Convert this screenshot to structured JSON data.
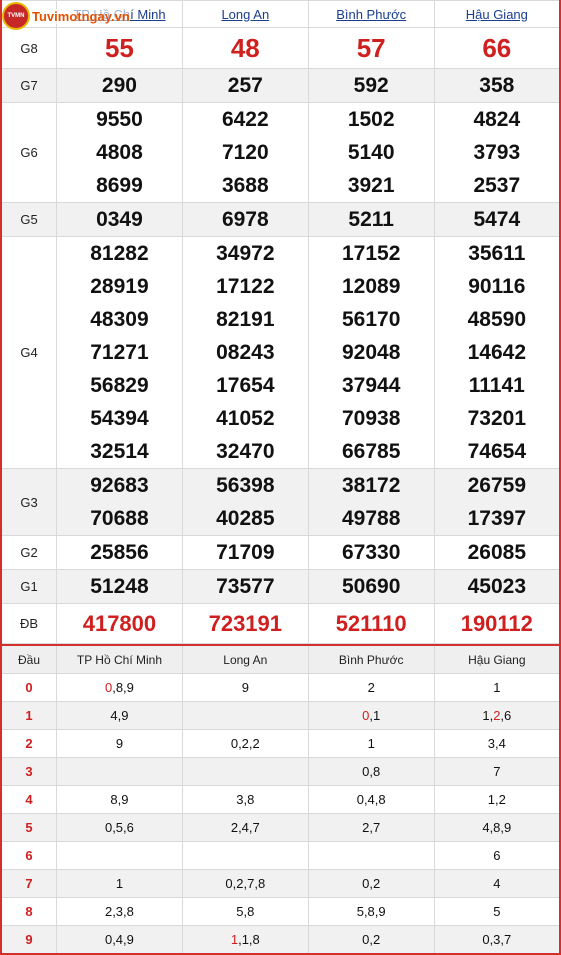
{
  "logo": {
    "text": "Tuvimotngay.vn",
    "badge": "TVMN"
  },
  "provinces": [
    "TP Hồ Chí Minh",
    "Long An",
    "Bình Phước",
    "Hậu Giang"
  ],
  "prizes": [
    {
      "label": "G8",
      "values": [
        [
          "55"
        ],
        [
          "48"
        ],
        [
          "57"
        ],
        [
          "66"
        ]
      ]
    },
    {
      "label": "G7",
      "values": [
        [
          "290"
        ],
        [
          "257"
        ],
        [
          "592"
        ],
        [
          "358"
        ]
      ]
    },
    {
      "label": "G6",
      "values": [
        [
          "9550",
          "4808",
          "8699"
        ],
        [
          "6422",
          "7120",
          "3688"
        ],
        [
          "1502",
          "5140",
          "3921"
        ],
        [
          "4824",
          "3793",
          "2537"
        ]
      ]
    },
    {
      "label": "G5",
      "values": [
        [
          "0349"
        ],
        [
          "6978"
        ],
        [
          "5211"
        ],
        [
          "5474"
        ]
      ]
    },
    {
      "label": "G4",
      "values": [
        [
          "81282",
          "28919",
          "48309",
          "71271",
          "56829",
          "54394",
          "32514"
        ],
        [
          "34972",
          "17122",
          "82191",
          "08243",
          "17654",
          "41052",
          "32470"
        ],
        [
          "17152",
          "12089",
          "56170",
          "92048",
          "37944",
          "70938",
          "66785"
        ],
        [
          "35611",
          "90116",
          "48590",
          "14642",
          "11141",
          "73201",
          "74654"
        ]
      ]
    },
    {
      "label": "G3",
      "values": [
        [
          "92683",
          "70688"
        ],
        [
          "56398",
          "40285"
        ],
        [
          "38172",
          "49788"
        ],
        [
          "26759",
          "17397"
        ]
      ]
    },
    {
      "label": "G2",
      "values": [
        [
          "25856"
        ],
        [
          "71709"
        ],
        [
          "67330"
        ],
        [
          "26085"
        ]
      ]
    },
    {
      "label": "G1",
      "values": [
        [
          "51248"
        ],
        [
          "73577"
        ],
        [
          "50690"
        ],
        [
          "45023"
        ]
      ]
    },
    {
      "label": "ĐB",
      "values": [
        [
          "417800"
        ],
        [
          "723191"
        ],
        [
          "521110"
        ],
        [
          "190112"
        ]
      ]
    }
  ],
  "loto_header": {
    "head": "Đầu",
    "provinces": [
      "TP Hồ Chí Minh",
      "Long An",
      "Bình Phước",
      "Hậu Giang"
    ]
  },
  "loto": [
    {
      "head": "0",
      "cells": [
        [
          {
            "t": "0",
            "hl": true
          },
          {
            "t": ",8,9"
          }
        ],
        [
          {
            "t": "9"
          }
        ],
        [
          {
            "t": "2"
          }
        ],
        [
          {
            "t": "1"
          }
        ]
      ]
    },
    {
      "head": "1",
      "cells": [
        [
          {
            "t": "4,9"
          }
        ],
        [],
        [
          {
            "t": "0",
            "hl": true
          },
          {
            "t": ",1"
          }
        ],
        [
          {
            "t": "1,"
          },
          {
            "t": "2",
            "hl": true
          },
          {
            "t": ",6"
          }
        ]
      ]
    },
    {
      "head": "2",
      "cells": [
        [
          {
            "t": "9"
          }
        ],
        [
          {
            "t": "0,2,2"
          }
        ],
        [
          {
            "t": "1"
          }
        ],
        [
          {
            "t": "3,4"
          }
        ]
      ]
    },
    {
      "head": "3",
      "cells": [
        [],
        [],
        [
          {
            "t": "0,8"
          }
        ],
        [
          {
            "t": "7"
          }
        ]
      ]
    },
    {
      "head": "4",
      "cells": [
        [
          {
            "t": "8,9"
          }
        ],
        [
          {
            "t": "3,8"
          }
        ],
        [
          {
            "t": "0,4,8"
          }
        ],
        [
          {
            "t": "1,2"
          }
        ]
      ]
    },
    {
      "head": "5",
      "cells": [
        [
          {
            "t": "0,5,6"
          }
        ],
        [
          {
            "t": "2,4,7"
          }
        ],
        [
          {
            "t": "2,7"
          }
        ],
        [
          {
            "t": "4,8,9"
          }
        ]
      ]
    },
    {
      "head": "6",
      "cells": [
        [],
        [],
        [],
        [
          {
            "t": "6"
          }
        ]
      ]
    },
    {
      "head": "7",
      "cells": [
        [
          {
            "t": "1"
          }
        ],
        [
          {
            "t": "0,2,7,8"
          }
        ],
        [
          {
            "t": "0,2"
          }
        ],
        [
          {
            "t": "4"
          }
        ]
      ]
    },
    {
      "head": "8",
      "cells": [
        [
          {
            "t": "2,3,8"
          }
        ],
        [
          {
            "t": "5,8"
          }
        ],
        [
          {
            "t": "5,8,9"
          }
        ],
        [
          {
            "t": "5"
          }
        ]
      ]
    },
    {
      "head": "9",
      "cells": [
        [
          {
            "t": "0,4,9"
          }
        ],
        [
          {
            "t": "1",
            "hl": true
          },
          {
            "t": ",1,8"
          }
        ],
        [
          {
            "t": "0,2"
          }
        ],
        [
          {
            "t": "0,3,7"
          }
        ]
      ]
    }
  ],
  "colors": {
    "accent_red": "#d01f1f",
    "link_blue": "#1a3d8f",
    "row_alt": "#f1f1f1"
  }
}
